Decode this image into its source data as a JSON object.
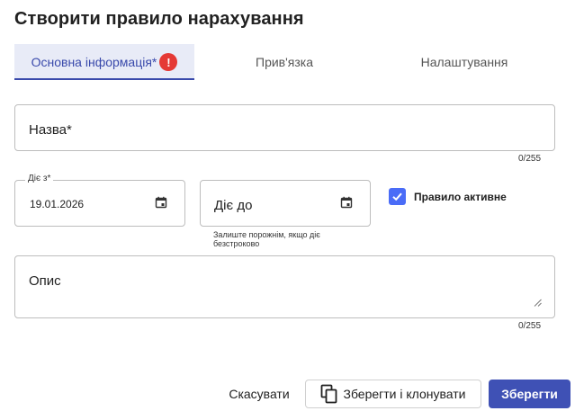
{
  "dialog": {
    "title": "Створити правило нарахування"
  },
  "tabs": [
    {
      "label": "Основна інформація*",
      "badge": "!",
      "active": true
    },
    {
      "label": "Прив'язка",
      "active": false
    },
    {
      "label": "Налаштування",
      "active": false
    }
  ],
  "form": {
    "name": {
      "label": "Назва*",
      "value": "",
      "counter": "0/255"
    },
    "valid_from": {
      "label": "Діє з*",
      "value": "19.01.2026"
    },
    "valid_to": {
      "label": "Діє до",
      "value": "",
      "hint": "Залиште порожнім, якщо діє безстроково"
    },
    "active": {
      "label": "Правило активне",
      "checked": true
    },
    "description": {
      "label": "Опис",
      "value": "",
      "counter": "0/255"
    }
  },
  "actions": {
    "cancel_label": "Скасувати",
    "save_clone_label": "Зберегти і клонувати",
    "save_label": "Зберегти"
  },
  "colors": {
    "accent": "#3f51b5",
    "tab_active_bg": "#e8ebf7",
    "error_badge": "#e53935",
    "checkbox": "#4a6cf7"
  },
  "icons": {
    "date_picker": "calendar-icon",
    "clone": "copy-icon",
    "checkbox": "check-icon"
  }
}
